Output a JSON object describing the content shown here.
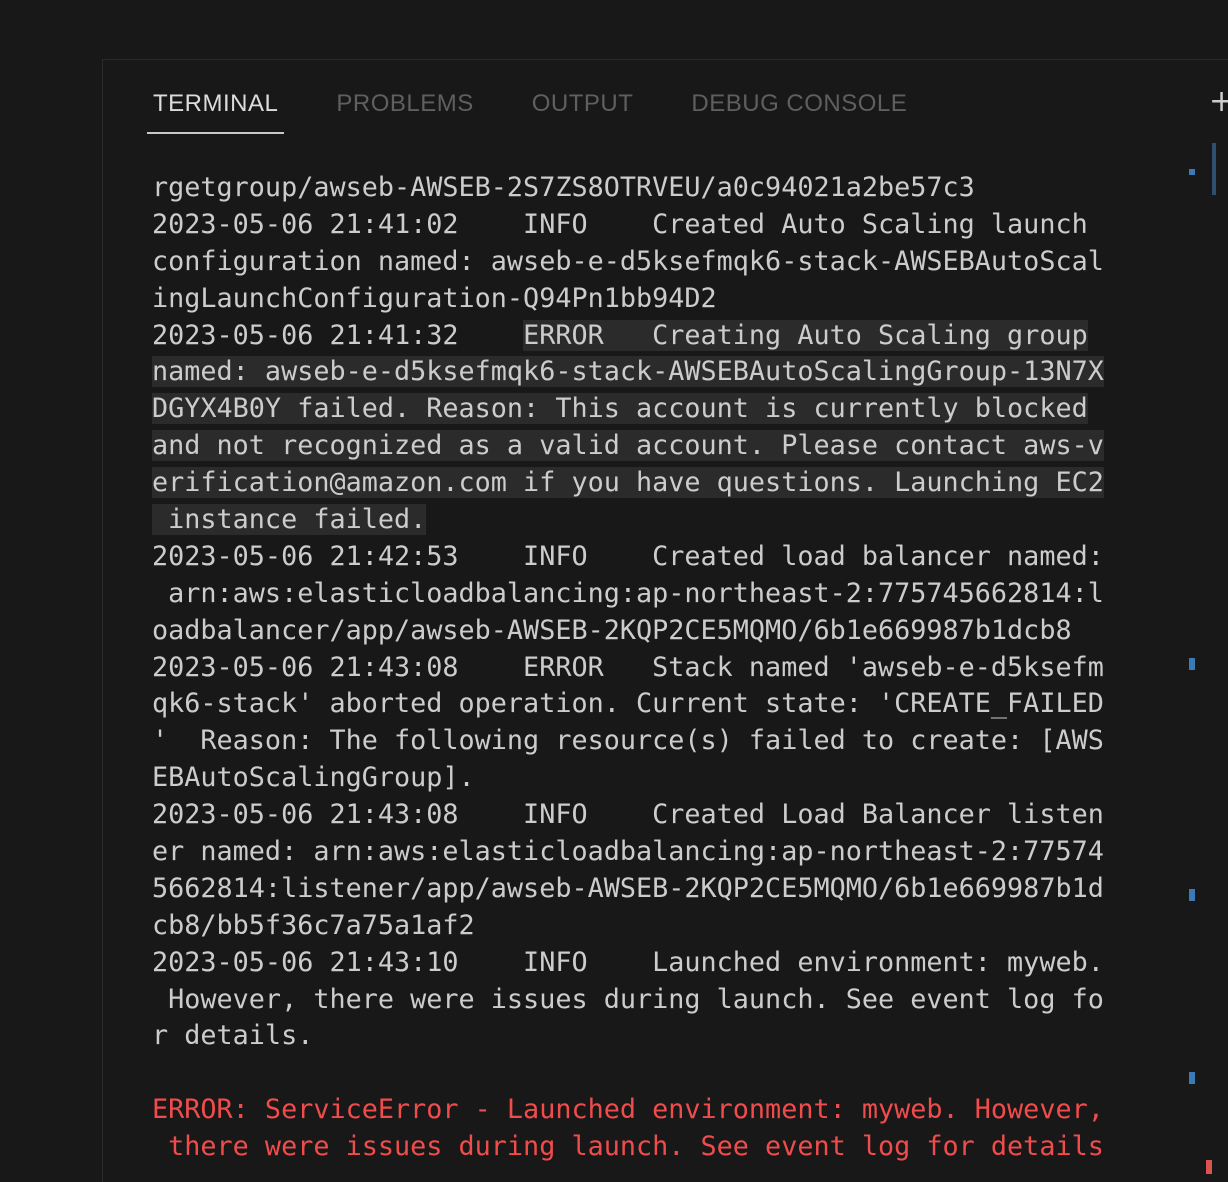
{
  "panel": {
    "tabs": [
      {
        "label": "TERMINAL",
        "active": true
      },
      {
        "label": "PROBLEMS",
        "active": false
      },
      {
        "label": "OUTPUT",
        "active": false
      },
      {
        "label": "DEBUG CONSOLE",
        "active": false
      }
    ],
    "new_terminal_icon": "plus-icon"
  },
  "terminal": {
    "lines": [
      "rgetgroup/awseb-AWSEB-2S7ZS8OTRVEU/a0c94021a2be57c3",
      "2023-05-06 21:41:02    INFO    Created Auto Scaling launch",
      "configuration named: awseb-e-d5ksefmqk6-stack-AWSEBAutoScal",
      "ingLaunchConfiguration-Q94Pn1bb94D2",
      "2023-05-06 21:41:32    ",
      "ERROR   Creating Auto Scaling group",
      "named: awseb-e-d5ksefmqk6-stack-AWSEBAutoScalingGroup-13N7X",
      "DGYX4B0Y failed. Reason: This account is currently blocked",
      "and not recognized as a valid account. Please contact aws-v",
      "erification@amazon.com if you have questions. Launching EC2",
      " instance failed.",
      "2023-05-06 21:42:53    INFO    Created load balancer named:",
      " arn:aws:elasticloadbalancing:ap-northeast-2:775745662814:l",
      "oadbalancer/app/awseb-AWSEB-2KQP2CE5MQMO/6b1e669987b1dcb8",
      "2023-05-06 21:43:08    ERROR   Stack named 'awseb-e-d5ksefm",
      "qk6-stack' aborted operation. Current state: 'CREATE_FAILED",
      "'  Reason: The following resource(s) failed to create: [AWS",
      "EBAutoScalingGroup].",
      "2023-05-06 21:43:08    INFO    Created Load Balancer listen",
      "er named: arn:aws:elasticloadbalancing:ap-northeast-2:77574",
      "5662814:listener/app/awseb-AWSEB-2KQP2CE5MQMO/6b1e669987b1d",
      "cb8/bb5f36c7a75a1af2",
      "2023-05-06 21:43:10    INFO    Launched environment: myweb.",
      " However, there were issues during launch. See event log fo",
      "r details.",
      "",
      "ERROR: ServiceError - Launched environment: myweb. However,",
      " there were issues during launch. See event log for details"
    ]
  },
  "colors": {
    "background": "#181818",
    "text": "#cccccc",
    "error_text": "#f14c4c",
    "selection": "#2b2b2b",
    "ruler_mark": "#3b79b7"
  }
}
